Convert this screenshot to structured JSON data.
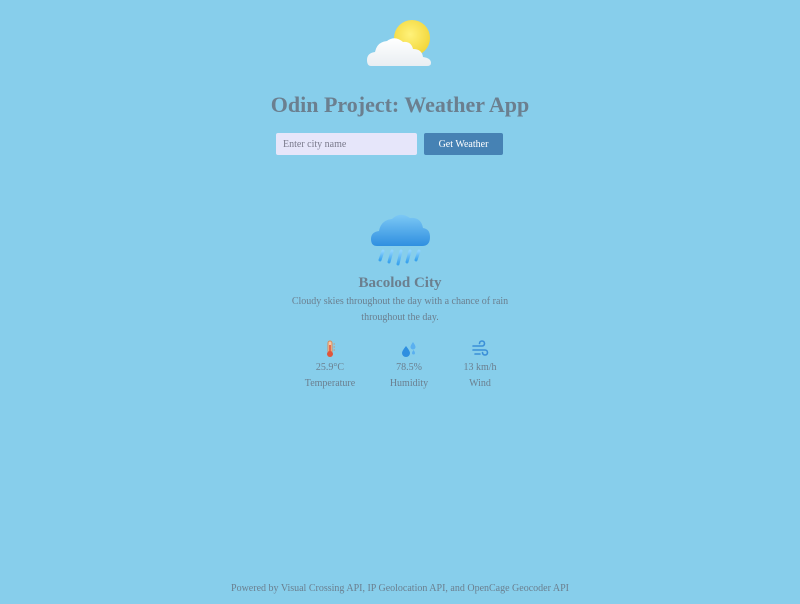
{
  "header": {
    "logo_icon": "partly-cloudy-sun-icon",
    "title": "Odin Project: Weather App"
  },
  "search": {
    "placeholder": "Enter city name",
    "value": "",
    "button_label": "Get Weather"
  },
  "weather": {
    "icon": "rain-cloud-icon",
    "city": "Bacolod City",
    "description": "Cloudy skies throughout the day with a chance of rain throughout the day.",
    "stats": [
      {
        "icon": "thermometer-icon",
        "value": "25.9°C",
        "label": "Temperature"
      },
      {
        "icon": "humidity-drops-icon",
        "value": "78.5%",
        "label": "Humidity"
      },
      {
        "icon": "wind-icon",
        "value": "13 km/h",
        "label": "Wind"
      }
    ]
  },
  "footer": {
    "text": "Powered by Visual Crossing API, IP Geolocation API, and OpenCage Geocoder API"
  },
  "colors": {
    "background": "#87ceeb",
    "button": "#4682b4",
    "input": "#e6e6fa",
    "text": "#6b7f8f"
  }
}
